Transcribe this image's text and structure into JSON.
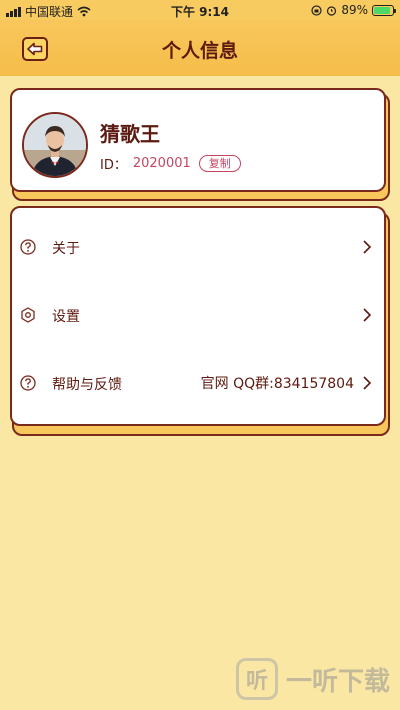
{
  "status_bar": {
    "carrier": "中国联通",
    "time": "下午 9:14",
    "battery": "89%",
    "battery_level": 0.89
  },
  "header": {
    "title": "个人信息"
  },
  "profile": {
    "name": "猜歌王",
    "id_label": "ID：",
    "id_value": "2020001",
    "copy_label": "复制"
  },
  "menu": [
    {
      "label": "关于",
      "value": "",
      "icon": "question-icon"
    },
    {
      "label": "设置",
      "value": "",
      "icon": "gear-icon"
    },
    {
      "label": "帮助与反馈",
      "value": "官网 QQ群:834157804",
      "icon": "question-icon"
    }
  ],
  "watermark": {
    "logo": "听",
    "text": "一听下载"
  },
  "colors": {
    "background": "#fbe7a4",
    "header": "#f8c75c",
    "border": "#7a2a1c",
    "accent": "#c6455f",
    "text": "#5c1a10"
  }
}
